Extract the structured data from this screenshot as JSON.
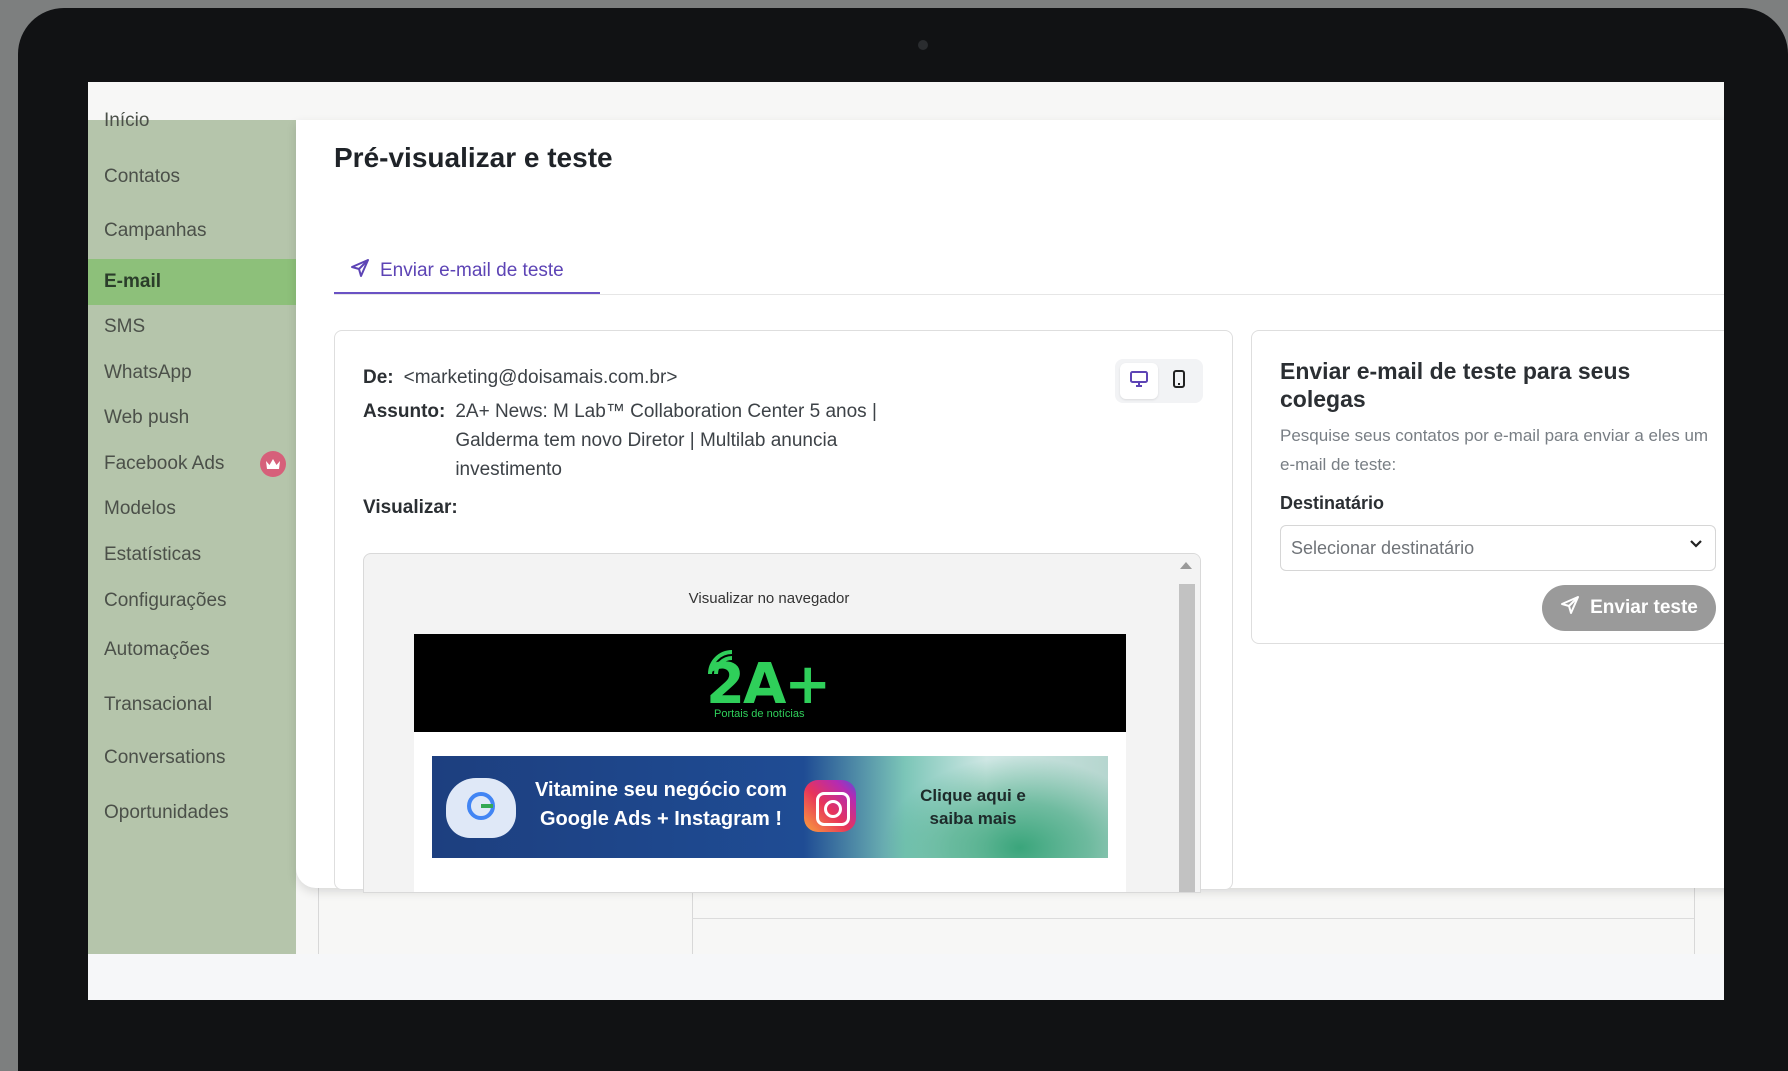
{
  "sidebar": {
    "items": [
      {
        "label": "Início",
        "active": false
      },
      {
        "label": "Contatos",
        "active": false
      },
      {
        "label": "Campanhas",
        "active": false
      },
      {
        "label": "E-mail",
        "active": true
      },
      {
        "label": "SMS",
        "active": false
      },
      {
        "label": "WhatsApp",
        "active": false
      },
      {
        "label": "Web push",
        "active": false
      },
      {
        "label": "Facebook Ads",
        "active": false,
        "badge_icon": "crown-icon"
      },
      {
        "label": "Modelos",
        "active": false
      },
      {
        "label": "Estatísticas",
        "active": false
      },
      {
        "label": "Configurações",
        "active": false
      },
      {
        "label": "Automações",
        "active": false
      },
      {
        "label": "Transacional",
        "active": false
      },
      {
        "label": "Conversations",
        "active": false
      },
      {
        "label": "Oportunidades",
        "active": false
      }
    ]
  },
  "panel": {
    "title": "Pré-visualizar e teste",
    "tab_label": "Enviar e-mail de teste",
    "tab_icon": "paper-plane-icon"
  },
  "email_meta": {
    "from_label": "De:",
    "from_value": "<marketing@doisamais.com.br>",
    "subject_label": "Assunto:",
    "subject_value": "2A+ News: M Lab™ Collaboration Center 5 anos | Galderma tem novo Diretor | Multilab anuncia investimento",
    "view_label": "Visualizar:",
    "device_options": [
      "desktop-icon",
      "mobile-icon"
    ],
    "selected_device": "desktop-icon"
  },
  "email_preview": {
    "browser_link": "Visualizar no navegador",
    "logo_text": "2A+",
    "logo_subtitle": "Portais de notícias",
    "banner_text": "Vitamine seu negócio com Google Ads + Instagram !",
    "banner_cta": "Clique aqui e saiba mais"
  },
  "send_test": {
    "title": "Enviar e-mail de teste para seus colegas",
    "description": "Pesquise seus contatos por e-mail para enviar a eles um e-mail de teste:",
    "recipient_label": "Destinatário",
    "recipient_placeholder": "Selecionar destinatário",
    "button_label": "Enviar teste"
  },
  "colors": {
    "accent": "#6a52c4",
    "sidebar_bg": "#b5c5ab",
    "sidebar_active": "#8dc07a",
    "logo_green": "#2fcf5a",
    "button_disabled": "#9a9a9a"
  }
}
